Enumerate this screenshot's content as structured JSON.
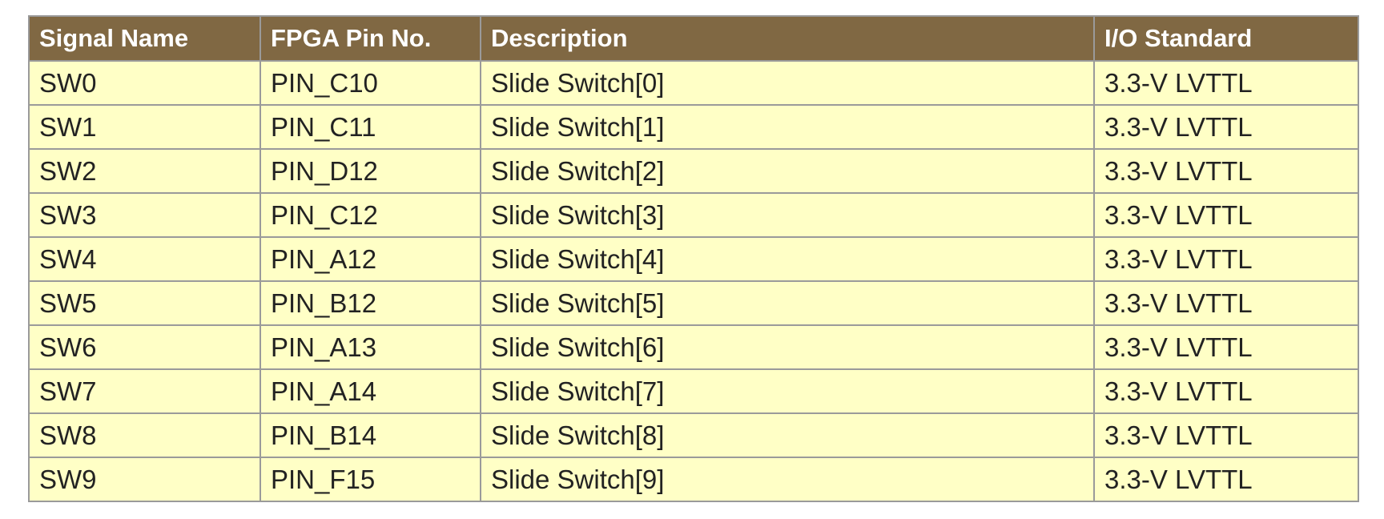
{
  "table": {
    "headers": [
      "Signal Name",
      "FPGA Pin No.",
      "Description",
      "I/O Standard"
    ],
    "rows": [
      [
        "SW0",
        "PIN_C10",
        "Slide Switch[0]",
        "3.3-V LVTTL"
      ],
      [
        "SW1",
        "PIN_C11",
        "Slide Switch[1]",
        "3.3-V LVTTL"
      ],
      [
        "SW2",
        "PIN_D12",
        "Slide Switch[2]",
        "3.3-V LVTTL"
      ],
      [
        "SW3",
        "PIN_C12",
        "Slide Switch[3]",
        "3.3-V LVTTL"
      ],
      [
        "SW4",
        "PIN_A12",
        "Slide Switch[4]",
        "3.3-V LVTTL"
      ],
      [
        "SW5",
        "PIN_B12",
        "Slide Switch[5]",
        "3.3-V LVTTL"
      ],
      [
        "SW6",
        "PIN_A13",
        "Slide Switch[6]",
        "3.3-V LVTTL"
      ],
      [
        "SW7",
        "PIN_A14",
        "Slide Switch[7]",
        "3.3-V LVTTL"
      ],
      [
        "SW8",
        "PIN_B14",
        "Slide Switch[8]",
        "3.3-V LVTTL"
      ],
      [
        "SW9",
        "PIN_F15",
        "Slide Switch[9]",
        "3.3-V LVTTL"
      ]
    ]
  },
  "colors": {
    "header_background": "#806843",
    "header_text": "#ffffff",
    "cell_background": "#ffffc6",
    "cell_text": "#222222",
    "border": "#9a9a9a"
  }
}
